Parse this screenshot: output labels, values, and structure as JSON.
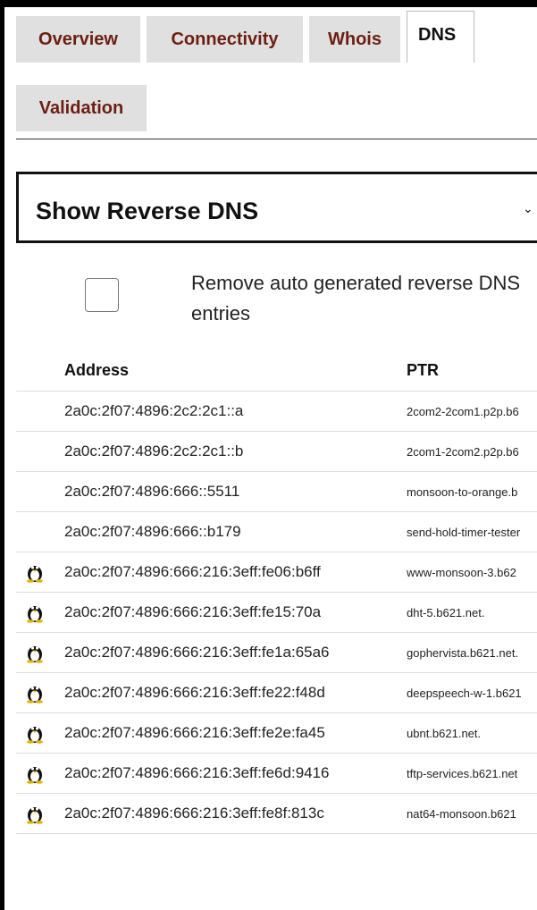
{
  "tabs": [
    {
      "label": "Overview",
      "active": false
    },
    {
      "label": "Connectivity",
      "active": false
    },
    {
      "label": "Whois",
      "active": false
    },
    {
      "label": "DNS",
      "active": true
    },
    {
      "label": "Validation",
      "active": false
    }
  ],
  "dns_view": {
    "selected": "Show Reverse DNS"
  },
  "filter": {
    "label": "Remove auto generated reverse DNS entries",
    "checked": false
  },
  "table": {
    "headers": {
      "address": "Address",
      "ptr": "PTR"
    },
    "rows": [
      {
        "address": "2a0c:2f07:4896:2c2:2c1::a",
        "ptr": "2com2-2com1.p2p.b6",
        "os_icon": ""
      },
      {
        "address": "2a0c:2f07:4896:2c2:2c1::b",
        "ptr": "2com1-2com2.p2p.b6",
        "os_icon": ""
      },
      {
        "address": "2a0c:2f07:4896:666::5511",
        "ptr": "monsoon-to-orange.b",
        "os_icon": ""
      },
      {
        "address": "2a0c:2f07:4896:666::b179",
        "ptr": "send-hold-timer-tester",
        "os_icon": ""
      },
      {
        "address": "2a0c:2f07:4896:666:216:3eff:fe06:b6ff",
        "ptr": "www-monsoon-3.b62",
        "os_icon": "linux-tux-icon"
      },
      {
        "address": "2a0c:2f07:4896:666:216:3eff:fe15:70a",
        "ptr": "dht-5.b621.net.",
        "os_icon": "linux-tux-icon"
      },
      {
        "address": "2a0c:2f07:4896:666:216:3eff:fe1a:65a6",
        "ptr": "gophervista.b621.net.",
        "os_icon": "linux-tux-icon"
      },
      {
        "address": "2a0c:2f07:4896:666:216:3eff:fe22:f48d",
        "ptr": "deepspeech-w-1.b621",
        "os_icon": "linux-tux-icon"
      },
      {
        "address": "2a0c:2f07:4896:666:216:3eff:fe2e:fa45",
        "ptr": "ubnt.b621.net.",
        "os_icon": "linux-tux-icon"
      },
      {
        "address": "2a0c:2f07:4896:666:216:3eff:fe6d:9416",
        "ptr": "tftp-services.b621.net",
        "os_icon": "linux-tux-icon"
      },
      {
        "address": "2a0c:2f07:4896:666:216:3eff:fe8f:813c",
        "ptr": "nat64-monsoon.b621",
        "os_icon": "linux-tux-icon"
      }
    ]
  }
}
